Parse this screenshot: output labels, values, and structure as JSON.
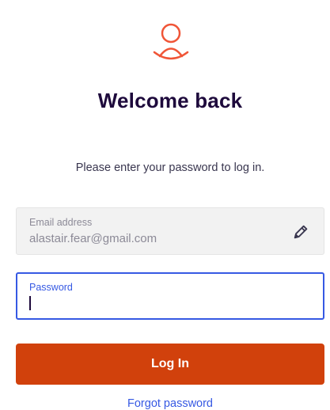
{
  "header": {
    "avatar_icon": "user-icon",
    "title": "Welcome back",
    "subtitle": "Please enter your password to log in."
  },
  "email": {
    "label": "Email address",
    "value": "alastair.fear@gmail.com",
    "edit_icon": "pencil-icon"
  },
  "password": {
    "label": "Password",
    "value": ""
  },
  "actions": {
    "login_label": "Log In",
    "forgot_label": "Forgot password"
  },
  "colors": {
    "brand": "#d1410c",
    "title": "#1e0a3c",
    "link": "#3659e3",
    "focus_border": "#3659e3",
    "disabled_field": "#f2f2f2"
  }
}
